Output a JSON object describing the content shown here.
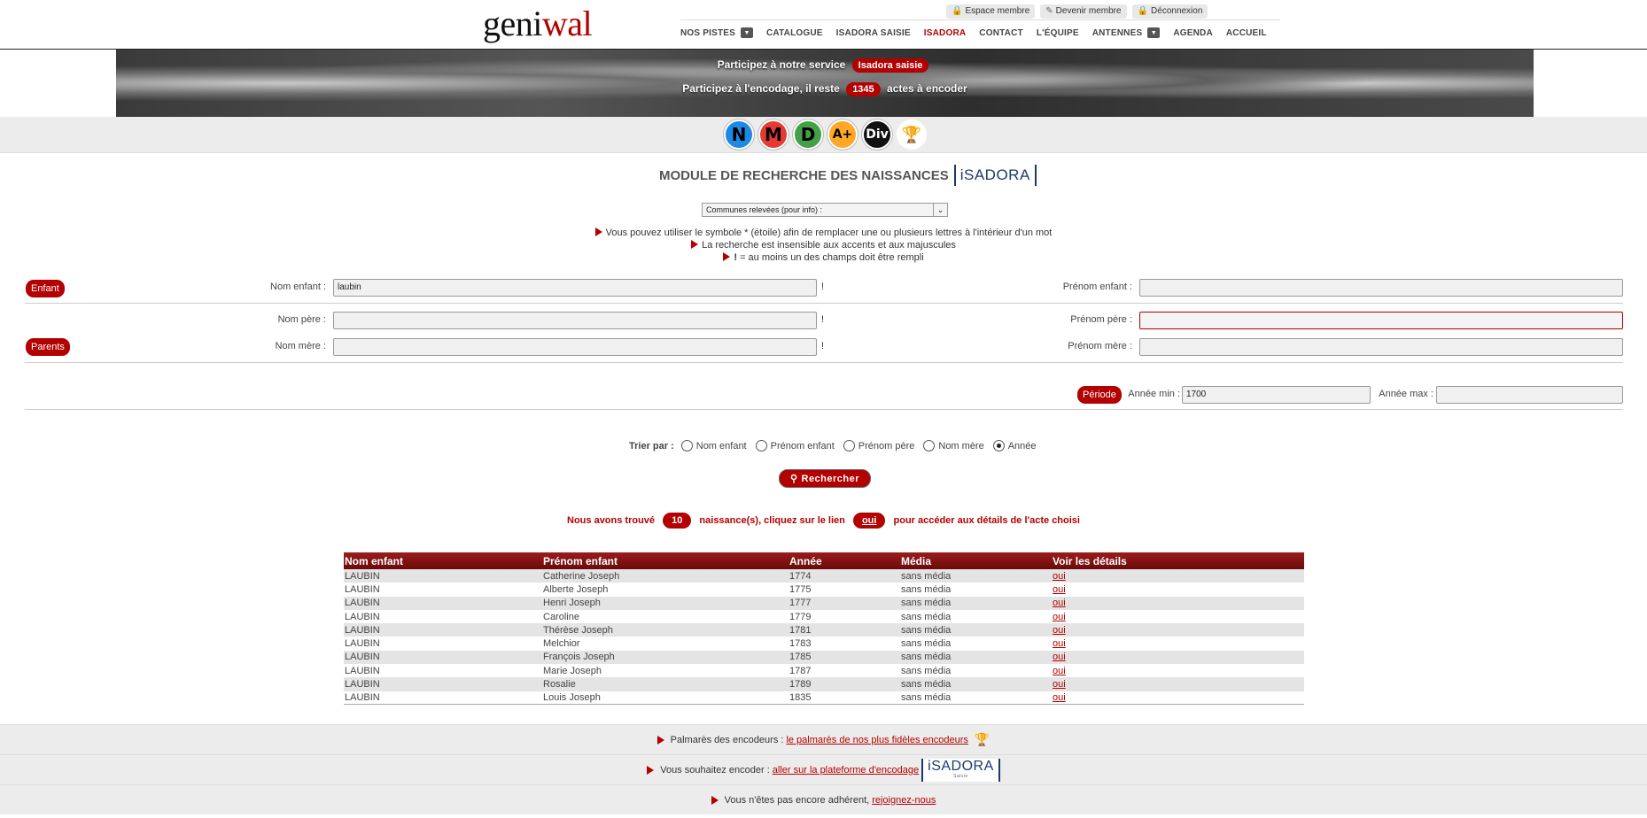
{
  "header": {
    "logo_part1": "geni",
    "logo_part2": "wal",
    "member_links": [
      "Espace membre",
      "Devenir membre",
      "Déconnexion"
    ],
    "nav": [
      "NOS PISTES",
      "CATALOGUE",
      "ISADORA SAISIE",
      "ISADORA",
      "CONTACT",
      "L'ÉQUIPE",
      "ANTENNES",
      "AGENDA",
      "ACCUEIL"
    ],
    "active_nav": "ISADORA"
  },
  "banner": {
    "line1_text": "Participez à notre service",
    "line1_pill": "Isadora saisie",
    "line2_before": "Participez à l'encodage, il reste",
    "line2_count": "1345",
    "line2_after": "actes à encoder"
  },
  "circle_icons": [
    {
      "label": "N",
      "color": "#1e88e5"
    },
    {
      "label": "M",
      "color": "#e53935"
    },
    {
      "label": "D",
      "color": "#43a047"
    },
    {
      "label": "A+",
      "color": "#ffa726"
    },
    {
      "label": "Div",
      "color": "#111111"
    }
  ],
  "module": {
    "title": "MODULE DE RECHERCHE DES NAISSANCES",
    "isadora_logo": "iSADORA",
    "communes_select": "Communes relevées (pour info) :",
    "hint1": "Vous pouvez utiliser le symbole * (étoile) afin de remplacer une ou plusieurs lettres à l'intérieur d'un mot",
    "hint2": "La recherche est insensible aux accents et aux majuscules",
    "hint3_bold": "!",
    "hint3_rest": " = au moins un des champs doit être rempli"
  },
  "form": {
    "enfant_pill": "Enfant",
    "parents_pill": "Parents",
    "periode_pill": "Période",
    "nom_enfant_label": "Nom enfant :",
    "nom_enfant_value": "laubin",
    "prenom_enfant_label": "Prénom enfant :",
    "nom_pere_label": "Nom père :",
    "prenom_pere_label": "Prénom père :",
    "nom_mere_label": "Nom mère :",
    "prenom_mere_label": "Prénom mère :",
    "annee_min_label": "Année min :",
    "annee_min_value": "1700",
    "annee_max_label": "Année max :",
    "excl": "!",
    "sort_label": "Trier par :",
    "sort_options": [
      "Nom enfant",
      "Prénom enfant",
      "Prénom père",
      "Nom mère",
      "Année"
    ],
    "sort_selected": "Année",
    "search_button": "Rechercher"
  },
  "results_summary": {
    "before": "Nous avons trouvé",
    "count": "10",
    "middle": "naissance(s), cliquez sur le lien",
    "link_word": "oui",
    "after": "pour accéder aux détails de l'acte choisi"
  },
  "table": {
    "headers": [
      "Nom enfant",
      "Prénom enfant",
      "Année",
      "Média",
      "Voir les détails"
    ],
    "rows": [
      [
        "LAUBIN",
        "Catherine Joseph",
        "1774",
        "sans média",
        "oui"
      ],
      [
        "LAUBIN",
        "Alberte Joseph",
        "1775",
        "sans média",
        "oui"
      ],
      [
        "LAUBIN",
        "Henri Joseph",
        "1777",
        "sans média",
        "oui"
      ],
      [
        "LAUBIN",
        "Caroline",
        "1779",
        "sans média",
        "oui"
      ],
      [
        "LAUBIN",
        "Thérèse Joseph",
        "1781",
        "sans média",
        "oui"
      ],
      [
        "LAUBIN",
        "Melchior",
        "1783",
        "sans média",
        "oui"
      ],
      [
        "LAUBIN",
        "François Joseph",
        "1785",
        "sans média",
        "oui"
      ],
      [
        "LAUBIN",
        "Marie Joseph",
        "1787",
        "sans média",
        "oui"
      ],
      [
        "LAUBIN",
        "Rosalie",
        "1789",
        "sans média",
        "oui"
      ],
      [
        "LAUBIN",
        "Louis Joseph",
        "1835",
        "sans média",
        "oui"
      ]
    ]
  },
  "footer": {
    "palmares_text": "Palmarès des encodeurs :",
    "palmares_link": "le palmarès de nos plus fidèles encodeurs",
    "encoder_text": "Vous souhaitez encoder :",
    "encoder_link": "aller sur la plateforme d'encodage",
    "isadora_logo": "iSADORA",
    "isadora_sub": "Saisie",
    "adherent_text": "Vous n'êtes pas encore adhérent,",
    "adherent_link": "rejoignez-nous"
  }
}
